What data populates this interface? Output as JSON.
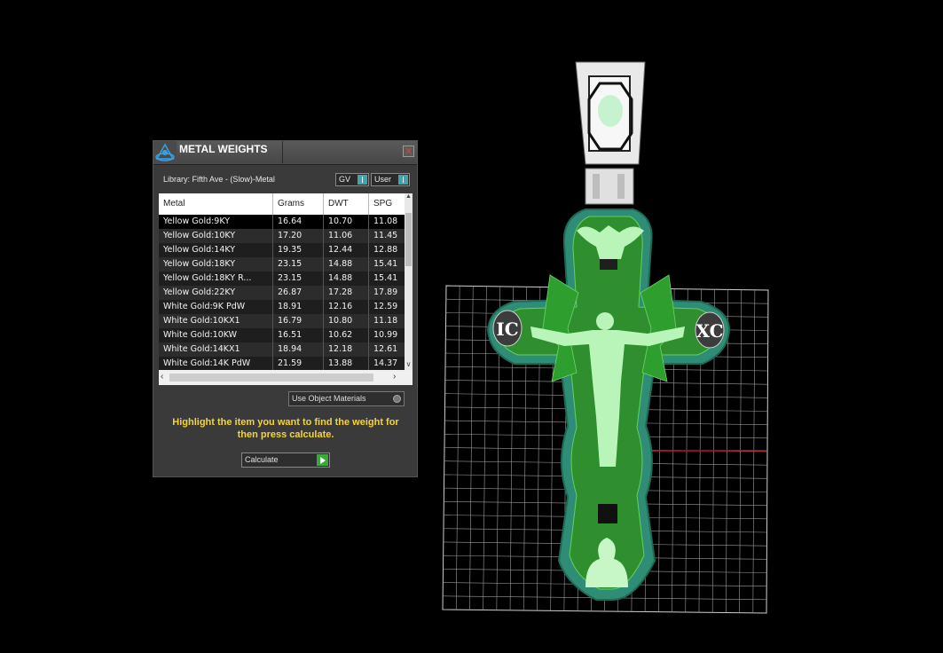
{
  "panel": {
    "title": "METAL WEIGHTS",
    "close_label": "✕",
    "library_label": "Library: Fifth Ave - (Slow)-Metal",
    "toggle_gv": "GV",
    "toggle_user": "User",
    "columns": [
      "Metal",
      "Grams",
      "DWT",
      "SPG"
    ],
    "rows": [
      [
        "Yellow Gold:9KY",
        "16.64",
        "10.70",
        "11.08"
      ],
      [
        "Yellow Gold:10KY",
        "17.20",
        "11.06",
        "11.45"
      ],
      [
        "Yellow Gold:14KY",
        "19.35",
        "12.44",
        "12.88"
      ],
      [
        "Yellow Gold:18KY",
        "23.15",
        "14.88",
        "15.41"
      ],
      [
        "Yellow Gold:18KY R...",
        "23.15",
        "14.88",
        "15.41"
      ],
      [
        "Yellow Gold:22KY",
        "26.87",
        "17.28",
        "17.89"
      ],
      [
        "White Gold:9K PdW",
        "18.91",
        "12.16",
        "12.59"
      ],
      [
        "White Gold:10KX1",
        "16.79",
        "10.80",
        "11.18"
      ],
      [
        "White Gold:10KW",
        "16.51",
        "10.62",
        "10.99"
      ],
      [
        "White Gold:14KX1",
        "18.94",
        "12.18",
        "12.61"
      ],
      [
        "White Gold:14K PdW",
        "21.59",
        "13.88",
        "14.37"
      ]
    ],
    "use_object_materials": "Use Object Materials",
    "hint": "Highlight the item you want to find the weight for then press calculate.",
    "calculate_label": "Calculate"
  },
  "viewport": {
    "cross_labels": [
      "IC",
      "XC"
    ],
    "colors": {
      "background": "#000000",
      "grid": "#ffffff",
      "wire_green": "#2f8f2f",
      "rim_teal": "#2b8a72",
      "figure": "#b9f5b9",
      "axis": "#b31e1e"
    }
  },
  "icons": {
    "logo": "triangle-globe-logo-icon",
    "close": "close-icon",
    "gv_toggle": "toggle-icon",
    "user_toggle": "toggle-icon",
    "use_obj": "radio-icon",
    "calculate": "play-arrow-icon"
  }
}
